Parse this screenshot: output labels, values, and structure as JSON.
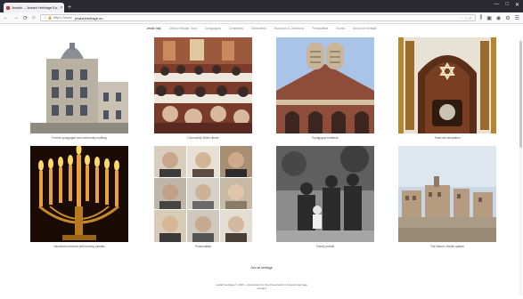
{
  "browser": {
    "tab_title": "Jewish – Jewish Heritage Eu...",
    "tab_close": "×",
    "new_tab": "+",
    "address_prefix": "ⓘ 🔒 https://www.",
    "address_host": "jewishheritage.eu",
    "address_actions": "⋯ ☆ ⟳",
    "nav_icons": [
      "←",
      "→",
      "⟳",
      "⌂"
    ],
    "toolbar_icons": [
      "⫼",
      "▣",
      "◉",
      "⚙",
      "☰"
    ],
    "window_controls": [
      "—",
      "□",
      "✕"
    ]
  },
  "site_nav": [
    "Jewish Italy",
    "Jewish Heritage Tours",
    "Synagogues",
    "Cemeteries",
    "Monuments",
    "Museums & Collections",
    "Personalities",
    "Events",
    "About the Heritage"
  ],
  "cards": [
    {
      "caption": "Former synagogue and community building",
      "image": "building-facade"
    },
    {
      "caption": "Community Seder dinner",
      "image": "dining-hall"
    },
    {
      "caption": "Synagogue entrance",
      "image": "tablets-facade"
    },
    {
      "caption": "Torah ark decoration",
      "image": "ark-star"
    },
    {
      "caption": "Hanukkah menorah with burning candles",
      "image": "menorah"
    },
    {
      "caption": "Personalities",
      "image": "portraits"
    },
    {
      "caption": "Family portrait",
      "image": "family-photo"
    },
    {
      "caption": "The historic Jewish quarter",
      "image": "town-square"
    }
  ],
  "more_label": "See all heritage",
  "footer": {
    "line1": "Jewish Heritage © 2015 – Association for the Preservation of Jewish Heritage",
    "line2": "Contact"
  },
  "colors": {
    "tabbar": "#2b2a33",
    "toolbar": "#f9f9fb",
    "accent": "#c33"
  }
}
